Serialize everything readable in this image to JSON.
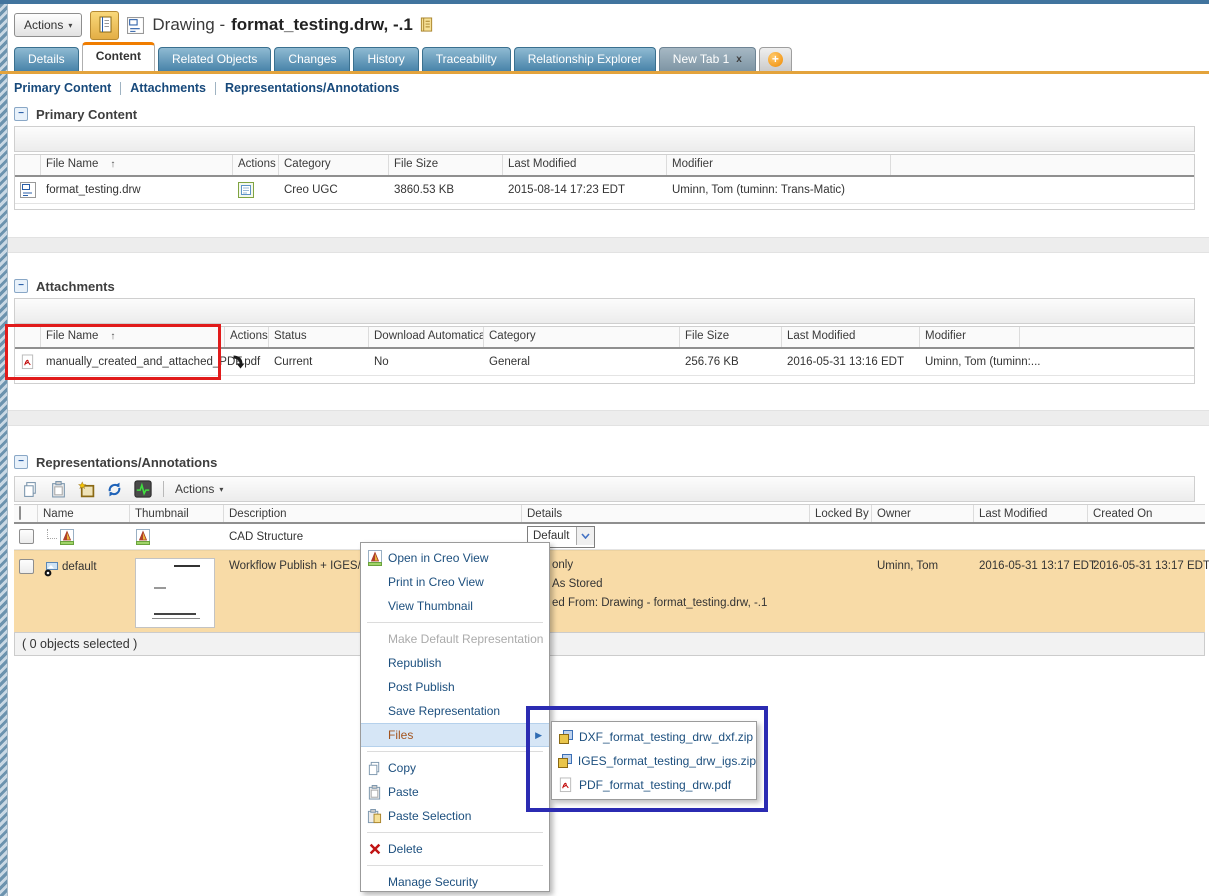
{
  "header": {
    "actions_button": "Actions",
    "title_prefix": "Drawing -",
    "title_name": "format_testing.drw, -.1"
  },
  "glyphs": {
    "collapse": "−",
    "sort_asc": "↑",
    "caret_down": "▾",
    "submenu_arrow": "▶",
    "close_x": "x",
    "add_plus": "+"
  },
  "tabs": {
    "items": [
      "Details",
      "Content",
      "Related Objects",
      "Changes",
      "History",
      "Traceability",
      "Relationship Explorer",
      "New Tab 1"
    ],
    "active": "Content"
  },
  "subnav": {
    "items": [
      "Primary Content",
      "Attachments",
      "Representations/Annotations"
    ]
  },
  "primary_content": {
    "title": "Primary Content",
    "columns": {
      "file_name": "File Name",
      "actions": "Actions",
      "category": "Category",
      "file_size": "File Size",
      "last_modified": "Last Modified",
      "modifier": "Modifier"
    },
    "row": {
      "file_name": "format_testing.drw",
      "category": "Creo UGC",
      "file_size": "3860.53 KB",
      "last_modified": "2015-08-14 17:23 EDT",
      "modifier": "Uminn, Tom (tuminn: Trans-Matic)"
    }
  },
  "attachments": {
    "title": "Attachments",
    "columns": {
      "file_name": "File Name",
      "actions": "Actions",
      "status": "Status",
      "download_automatically": "Download Automatically",
      "category": "Category",
      "file_size": "File Size",
      "last_modified": "Last Modified",
      "modifier": "Modifier"
    },
    "row": {
      "file_name": "manually_created_and_attached_PDF.pdf",
      "status": "Current",
      "download_automatically": "No",
      "category": "General",
      "file_size": "256.76 KB",
      "last_modified": "2016-05-31 13:16 EDT",
      "modifier": "Uminn, Tom (tuminn:..."
    }
  },
  "representations": {
    "title": "Representations/Annotations",
    "toolbar_actions": "Actions",
    "columns": {
      "name": "Name",
      "thumbnail": "Thumbnail",
      "description": "Description",
      "details": "Details",
      "locked_by": "Locked By",
      "owner": "Owner",
      "last_modified": "Last Modified",
      "created_on": "Created On"
    },
    "rows": [
      {
        "description": "CAD Structure",
        "details_value": "Default"
      },
      {
        "name": "default",
        "description": "Workflow Publish + IGES/D",
        "details_line1": "only",
        "details_line2": "As Stored",
        "details_line3": "ed From: Drawing - format_testing.drw, -.1",
        "owner": "Uminn, Tom",
        "last_modified": "2016-05-31 13:17 EDT",
        "created_on": "2016-05-31 13:17 EDT"
      }
    ],
    "status_bar": "( 0 objects selected )"
  },
  "context_menu": {
    "items": [
      {
        "label": "Open in Creo View",
        "icon": "creo-view-icon"
      },
      {
        "label": "Print in Creo View"
      },
      {
        "label": "View Thumbnail"
      },
      {
        "label": "Make Default Representation",
        "disabled": true
      },
      {
        "label": "Republish"
      },
      {
        "label": "Post Publish"
      },
      {
        "label": "Save Representation"
      },
      {
        "label": "Files",
        "highlighted": true,
        "has_submenu": true
      },
      {
        "label": "Copy",
        "icon": "copy-icon"
      },
      {
        "label": "Paste",
        "icon": "paste-icon"
      },
      {
        "label": "Paste Selection",
        "icon": "paste-selection-icon"
      },
      {
        "label": "Delete",
        "icon": "delete-icon"
      },
      {
        "label": "Manage Security"
      }
    ]
  },
  "files_submenu": {
    "items": [
      {
        "label": "DXF_format_testing_drw_dxf.zip",
        "icon": "zip-file-icon"
      },
      {
        "label": "IGES_format_testing_drw_igs.zip",
        "icon": "zip-file-icon"
      },
      {
        "label": "PDF_format_testing_drw.pdf",
        "icon": "pdf-file-icon"
      }
    ]
  },
  "colors": {
    "tab_active_accent": "#F07D00",
    "tab_blue": "#5E99BB",
    "gold_line": "#E3A33C",
    "highlight_row": "#F8DBA7",
    "annotation_red": "#E11B1B",
    "annotation_blue": "#2B2BB2"
  }
}
